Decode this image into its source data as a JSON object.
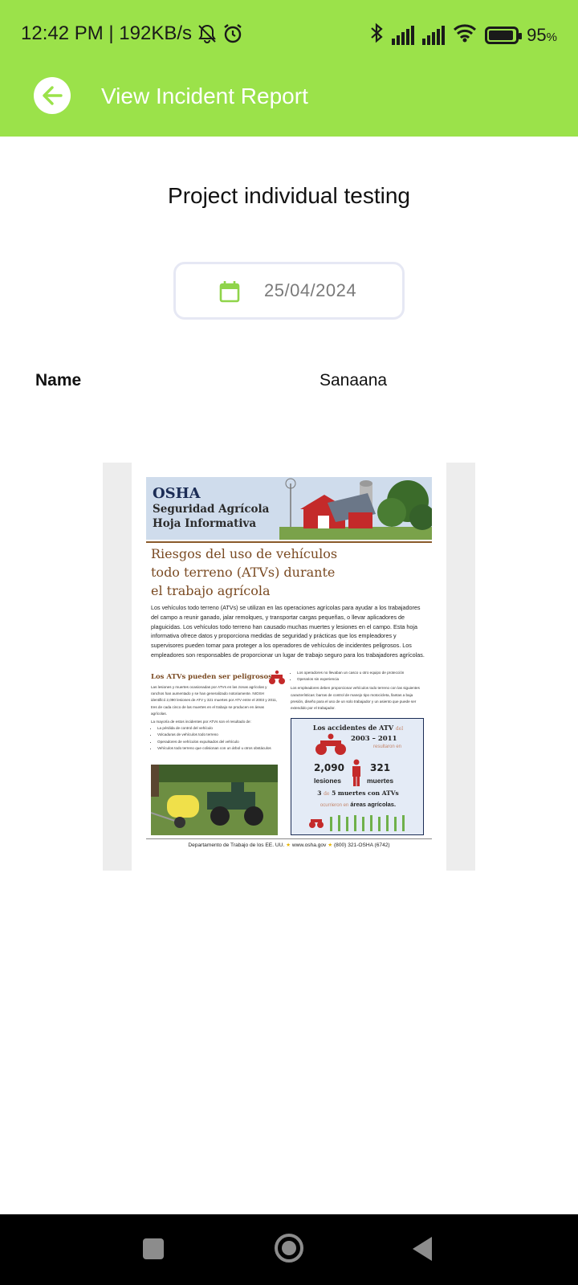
{
  "status_bar": {
    "time_network": "12:42 PM | 192KB/s",
    "battery_percent": "95",
    "battery_suffix": "%",
    "battery_level": 0.95
  },
  "app_bar": {
    "title": "View Incident Report"
  },
  "report": {
    "project_title": "Project individual testing",
    "date": "25/04/2024",
    "name_label": "Name",
    "name_value": "Sanaana"
  },
  "document": {
    "osha": "OSHA",
    "header_line1": "Seguridad Agrícola",
    "header_line2": "Hoja Informativa",
    "title_line1": "Riesgos del uso de vehículos",
    "title_line2": "todo terreno (ATVs) durante",
    "title_line3": "el trabajo agrícola",
    "body": "Los vehículos todo terreno (ATVs) se utilizan en las operaciones agrícolas para ayudar a los trabajadores del campo a reunir ganado, jalar remolques, y transportar cargas pequeñas, o llevar aplicadores de plaguicidas. Los vehículos todo terreno han causado muchas muertes y lesiones en el campo. Esta hoja informativa ofrece datos y proporciona medidas de seguridad y prácticas que los empleadores y supervisores pueden tomar para proteger a los operadores de vehículos de incidentes peligrosos. Los empleadores son responsables de proporcionar un lugar de trabajo seguro para los trabajadores agrícolas.",
    "section_heading": "Los ATVs pueden ser peligrosos",
    "left_para": "Las lesiones y muertes ocasionadas por ATVs en las zonas agrícolas y ranchos han aumentado y se han generalizado notoriamente. NIOSH identificó 2,090 lesiones de ATV y 321 muertes por ATV entre el 2003 y 2011, tres de cada cinco de las muertes en el trabajo se producen en áreas agrícolas.",
    "left_intro": "La mayoría de estos incidentes por ATVs son el resultado de:",
    "left_bullets": [
      "La pérdida de control del vehículo",
      "Volcaduras de vehículos todo terreno",
      "Operadores de vehículos expulsados del vehículo",
      "Vehículos todo terreno que colisionan con un árbol u otros obstáculos"
    ],
    "right_bullets": [
      "Los operadores no llevaban un casco u otro equipo de protección",
      "Operarios sin experiencia"
    ],
    "right_para": "Los empleadores deben proporcionar vehículos todo terreno con las siguientes características: barras de control de manejo tipo motocicleta, llantas a baja presión, diseño para el uso de un solo trabajador y un asiento que puede ser extendido por el trabajador.",
    "stat_box": {
      "line1": "Los accidentes de ATV",
      "line1_small": "del",
      "years": "2003 – 2011",
      "resulted": "resultaron en",
      "injuries_number": "2,090",
      "injuries_label": "lesiones",
      "deaths_number": "321",
      "deaths_label": "muertes",
      "ratio_a": "3",
      "ratio_de": "de",
      "ratio_b": "5 muertes con ATVs",
      "occurred": "ocurrieron en",
      "areas": "áreas agrícolas."
    },
    "footer_dept": "Departamento de Trabajo de los EE. UU.",
    "footer_web": "www.osha.gov",
    "footer_phone": "(800) 321-OSHA (6742)"
  },
  "colors": {
    "app_green": "#9be24a",
    "calendar_green": "#8fd44a",
    "doc_brown": "#7a4a22",
    "osha_navy": "#1b2c55"
  },
  "icons": {
    "back": "arrow-left-icon",
    "calendar": "calendar-icon"
  }
}
